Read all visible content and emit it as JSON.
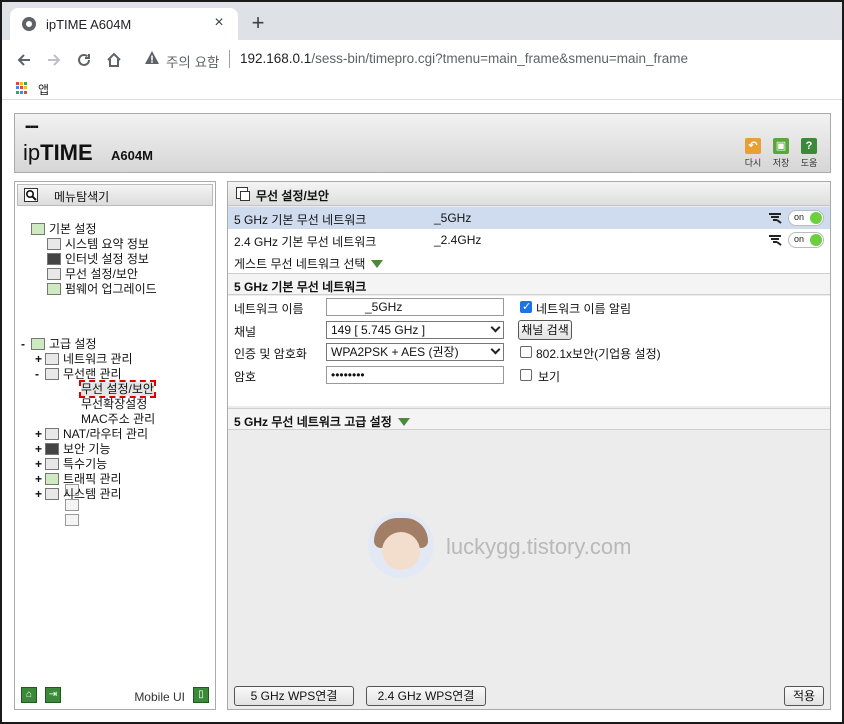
{
  "browser": {
    "tab_title": "ipTIME A604M",
    "tab_close": "×",
    "new_tab": "+",
    "security_warning": "주의 요함",
    "url_host": "192.168.0.1",
    "url_path": "/sess-bin/timepro.cgi?tmenu=main_frame&smenu=main_frame",
    "bookmark_apps": "앱"
  },
  "header": {
    "logo_dots": "▪▪▪▪▪",
    "logo_ip": "ip",
    "logo_time": "TIME",
    "model": "A604M",
    "buttons": [
      {
        "label": "다시",
        "icon": "undo-icon",
        "color": "#e8a030"
      },
      {
        "label": "저장",
        "icon": "save-icon",
        "color": "#5aa83a"
      },
      {
        "label": "도움",
        "icon": "help-icon",
        "color": "#3a8a3a"
      }
    ]
  },
  "nav": {
    "title": "메뉴탐색기",
    "basic": {
      "label": "기본 설정",
      "items": [
        "시스템 요약 정보",
        "인터넷 설정 정보",
        "무선 설정/보안",
        "펌웨어 업그레이드"
      ]
    },
    "advanced": {
      "label": "고급 설정",
      "expand": "-",
      "items": [
        {
          "label": "네트워크 관리",
          "expand": "+"
        },
        {
          "label": "무선랜 관리",
          "expand": "-"
        },
        {
          "label": "무선 설정/보안",
          "expand": ""
        },
        {
          "label": "무선확장설정",
          "expand": ""
        },
        {
          "label": "MAC주소 관리",
          "expand": ""
        },
        {
          "label": "NAT/라우터 관리",
          "expand": "+"
        },
        {
          "label": "보안 기능",
          "expand": "+"
        },
        {
          "label": "특수기능",
          "expand": "+"
        },
        {
          "label": "트래픽 관리",
          "expand": "+"
        },
        {
          "label": "시스템 관리",
          "expand": "+"
        }
      ]
    },
    "mobile_ui": "Mobile UI"
  },
  "main": {
    "title": "무선 설정/보안",
    "networks": [
      {
        "label": "5 GHz 기본 무선 네트워크",
        "ssid": "_5GHz",
        "state": "on"
      },
      {
        "label": "2.4 GHz 기본 무선 네트워크",
        "ssid": "_2.4GHz",
        "state": "on"
      }
    ],
    "guest": "게스트 무선 네트워크 선택",
    "basic_section": "5 GHz 기본 무선 네트워크",
    "form": {
      "network_name_label": "네트워크 이름",
      "network_name_value": "_5GHz",
      "broadcast_label": "네트워크 이름 알림",
      "broadcast_checked": true,
      "channel_label": "채널",
      "channel_value": "149 [ 5.745 GHz ]",
      "channel_scan": "채널 검색",
      "auth_label": "인증 및 암호화",
      "auth_value": "WPA2PSK + AES (권장)",
      "enterprise_label": "802.1x보안(기업용 설정)",
      "password_label": "암호",
      "password_value": "••••••••",
      "show_label": "보기"
    },
    "advanced_section": "5 GHz 무선 네트워크 고급 설정",
    "watermark": "luckygg.tistory.com",
    "buttons": {
      "wps5": "5 GHz WPS연결",
      "wps24": "2.4 GHz WPS연결",
      "apply": "적용"
    }
  }
}
